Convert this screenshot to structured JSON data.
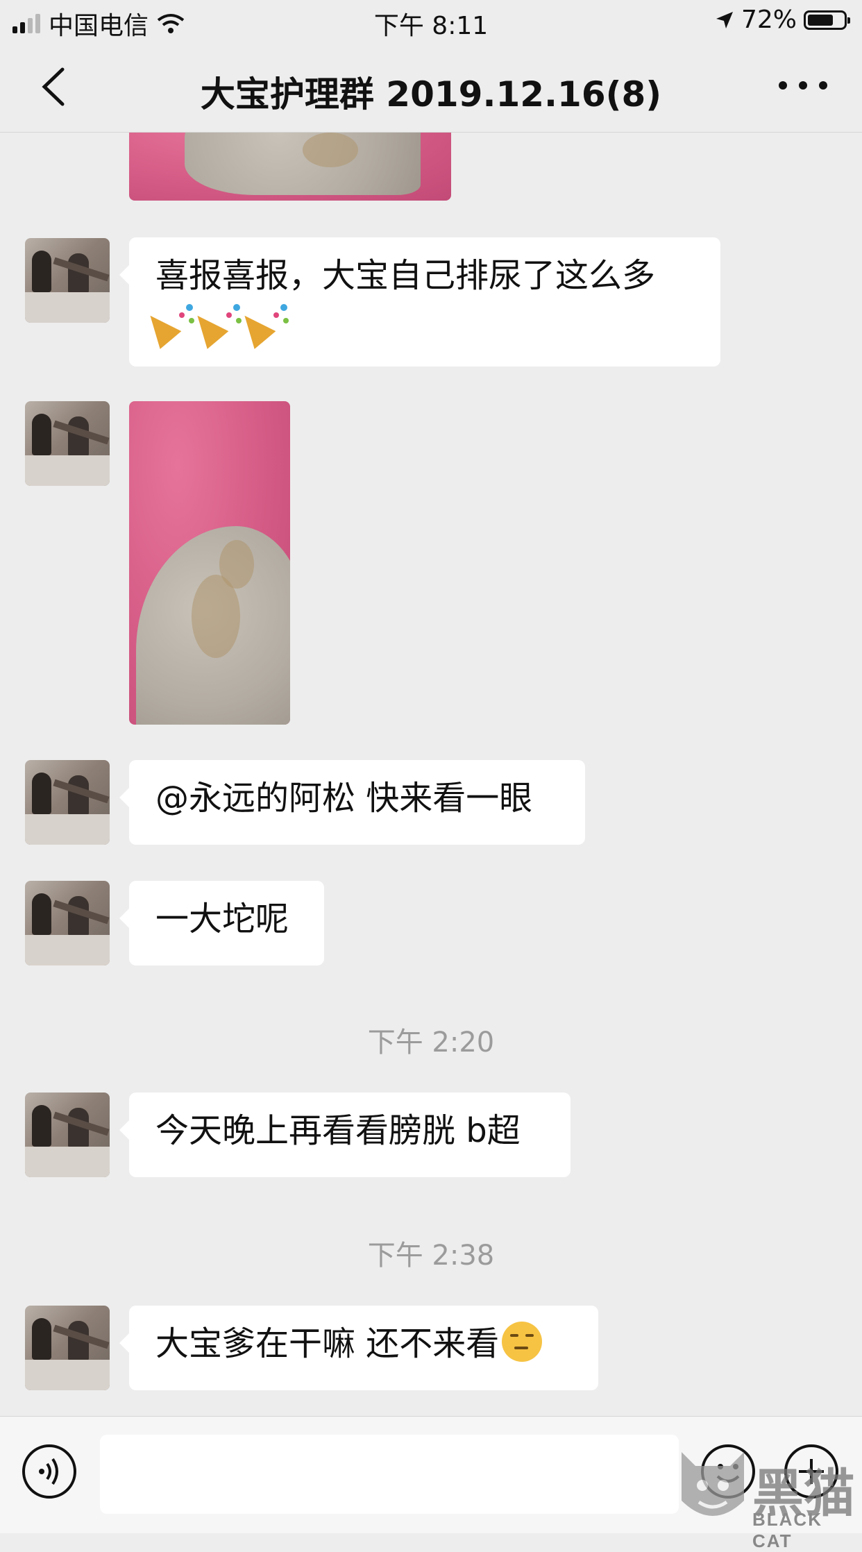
{
  "status_bar": {
    "carrier": "中国电信",
    "time": "下午 8:11",
    "battery_percent": "72%",
    "battery_level": 0.72
  },
  "nav": {
    "title": "大宝护理群 2019.12.16(8)",
    "back_icon": "chevron-left-icon",
    "more_icon": "more-dots-icon"
  },
  "messages": [
    {
      "type": "image",
      "desc_icon": "litter-photo"
    },
    {
      "type": "text",
      "text": "喜报喜报，大宝自己排尿了这么多",
      "emoji": "party-popper-icon"
    },
    {
      "type": "image",
      "desc_icon": "litter-photo"
    },
    {
      "type": "text",
      "text": "@永远的阿松 快来看一眼"
    },
    {
      "type": "text",
      "text": "一大坨呢"
    },
    {
      "type": "time",
      "text": "下午 2:20"
    },
    {
      "type": "text",
      "text": "今天晚上再看看膀胱 b超"
    },
    {
      "type": "time",
      "text": "下午 2:38"
    },
    {
      "type": "text",
      "text": "大宝爹在干嘛 还不来看",
      "emoji": "unamused-face-icon"
    }
  ],
  "input_bar": {
    "placeholder": "",
    "voice_icon": "voice-icon",
    "emoji_icon": "emoji-icon",
    "plus_icon": "plus-icon"
  },
  "watermark": {
    "chars": "黑猫",
    "label": "BLACK CAT"
  }
}
